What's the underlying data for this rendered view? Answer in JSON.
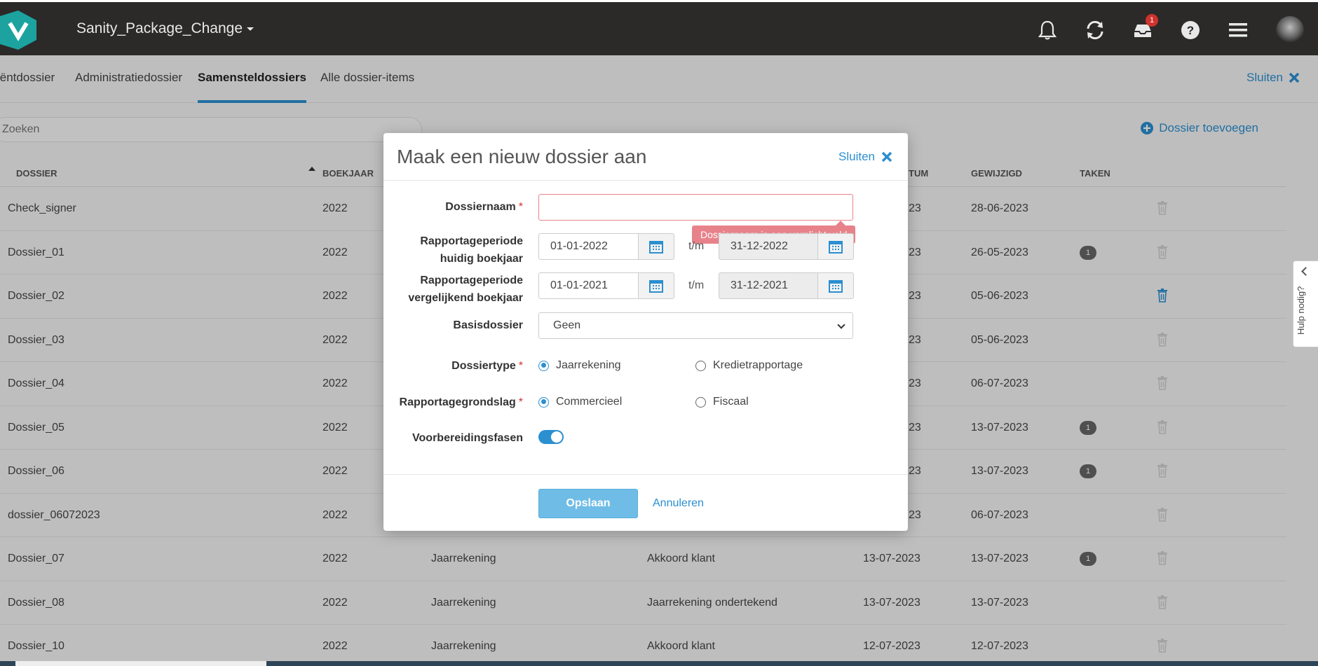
{
  "header": {
    "title": "Sanity_Package_Change",
    "notification_count": "1",
    "colors": {
      "bar": "#2b2a28",
      "accent": "#2b8fd0"
    }
  },
  "tabs": [
    {
      "label": "iëntdossier"
    },
    {
      "label": "Administratiedossier"
    },
    {
      "label": "Samensteldossiers"
    },
    {
      "label": "Alle dossier-items"
    }
  ],
  "close_label": "Sluiten",
  "search": {
    "placeholder": "Zoeken"
  },
  "add_dossier_label": "Dossier toevoegen",
  "table": {
    "columns": [
      "DOSSIER",
      "BOEKJAAR",
      "TUM",
      "GEWIJZIGD",
      "TAKEN"
    ],
    "rows": [
      {
        "name": "Check_signer",
        "year": "2022",
        "type": "",
        "status": "",
        "date": "",
        "date_visible": "23",
        "modified": "28-06-2023",
        "tasks": ""
      },
      {
        "name": "Dossier_01",
        "year": "2022",
        "type": "",
        "status": "",
        "date": "",
        "date_visible": "23",
        "modified": "26-05-2023",
        "tasks": "1"
      },
      {
        "name": "Dossier_02",
        "year": "2022",
        "type": "",
        "status": "",
        "date": "",
        "date_visible": "23",
        "modified": "05-06-2023",
        "tasks": ""
      },
      {
        "name": "Dossier_03",
        "year": "2022",
        "type": "",
        "status": "",
        "date": "",
        "date_visible": "23",
        "modified": "05-06-2023",
        "tasks": ""
      },
      {
        "name": "Dossier_04",
        "year": "2022",
        "type": "",
        "status": "",
        "date": "",
        "date_visible": "23",
        "modified": "06-07-2023",
        "tasks": ""
      },
      {
        "name": "Dossier_05",
        "year": "2022",
        "type": "",
        "status": "",
        "date": "",
        "date_visible": "23",
        "modified": "13-07-2023",
        "tasks": "1"
      },
      {
        "name": "Dossier_06",
        "year": "2022",
        "type": "",
        "status": "",
        "date": "",
        "date_visible": "23",
        "modified": "13-07-2023",
        "tasks": "1"
      },
      {
        "name": "dossier_06072023",
        "year": "2022",
        "type": "",
        "status": "",
        "date": "",
        "date_visible": "23",
        "modified": "06-07-2023",
        "tasks": ""
      },
      {
        "name": "Dossier_07",
        "year": "2022",
        "type": "Jaarrekening",
        "status": "Akkoord klant",
        "date": "13-07-2023",
        "date_visible": "",
        "modified": "13-07-2023",
        "tasks": "1"
      },
      {
        "name": "Dossier_08",
        "year": "2022",
        "type": "Jaarrekening",
        "status": "Jaarrekening ondertekend",
        "date": "13-07-2023",
        "date_visible": "",
        "modified": "13-07-2023",
        "tasks": ""
      },
      {
        "name": "Dossier_10",
        "year": "2022",
        "type": "Jaarrekening",
        "status": "Akkoord klant",
        "date": "12-07-2023",
        "date_visible": "",
        "modified": "12-07-2023",
        "tasks": ""
      }
    ]
  },
  "modal": {
    "title": "Maak een nieuw dossier aan",
    "close_label": "Sluiten",
    "fields": {
      "name_label": "Dossiernaam",
      "name_value": "",
      "error": "Dossiernaam is een verplicht veld",
      "period_current_label_1": "Rapportageperiode",
      "period_current_label_2": "huidig boekjaar",
      "period_current_from": "01-01-2022",
      "period_current_to": "31-12-2022",
      "period_compare_label_1": "Rapportageperiode",
      "period_compare_label_2": "vergelijkend boekjaar",
      "period_compare_from": "01-01-2021",
      "period_compare_to": "31-12-2021",
      "tm": "t/m",
      "base_label": "Basisdossier",
      "base_value": "Geen",
      "type_label": "Dossiertype",
      "type_options": [
        "Jaarrekening",
        "Kredietrapportage"
      ],
      "basis_label": "Rapportagegrondslag",
      "basis_options": [
        "Commercieel",
        "Fiscaal"
      ],
      "prep_label": "Voorbereidingsfasen",
      "prep_enabled": true
    },
    "save_label": "Opslaan",
    "cancel_label": "Annuleren"
  },
  "help_label": "Hulp nodig?"
}
